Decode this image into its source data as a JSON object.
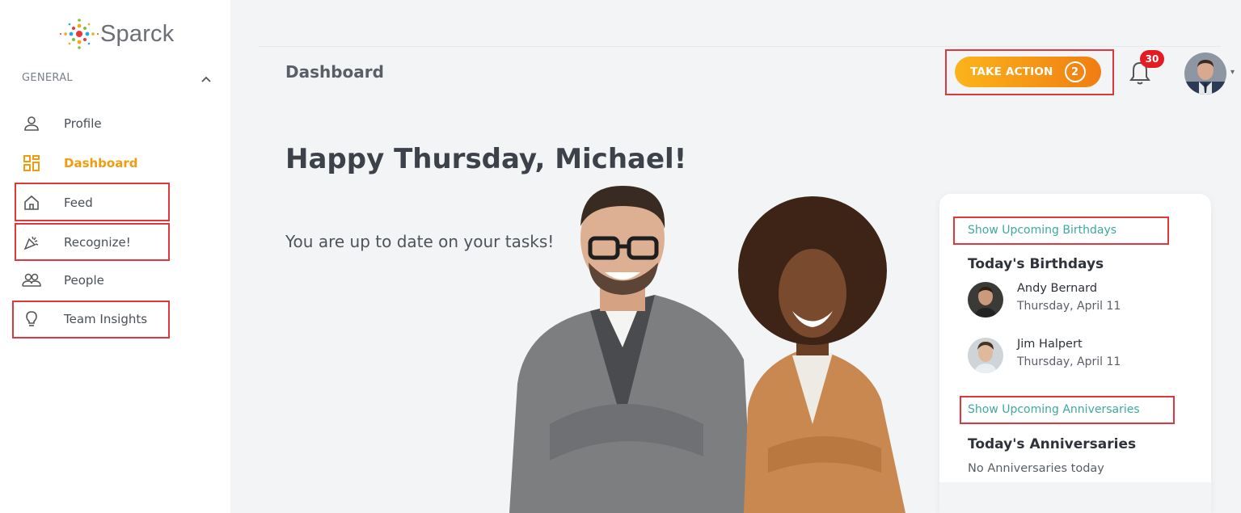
{
  "brand": {
    "name": "Sparck"
  },
  "sidebar": {
    "section_title": "GENERAL",
    "items": [
      {
        "label": "Profile",
        "icon": "user-icon"
      },
      {
        "label": "Dashboard",
        "icon": "grid-icon",
        "active": true
      },
      {
        "label": "Feed",
        "icon": "home-icon"
      },
      {
        "label": "Recognize!",
        "icon": "party-popper-icon"
      },
      {
        "label": "People",
        "icon": "people-icon"
      },
      {
        "label": "Team Insights",
        "icon": "lightbulb-icon"
      }
    ]
  },
  "header": {
    "title": "Dashboard",
    "take_action_label": "TAKE ACTION",
    "take_action_count": "2",
    "notification_count": "30"
  },
  "main": {
    "greeting": "Happy Thursday, Michael!",
    "status": "You are up to date on your tasks!"
  },
  "card": {
    "birthdays_link": "Show Upcoming Birthdays",
    "birthdays_heading": "Today's Birthdays",
    "birthdays": [
      {
        "name": "Andy Bernard",
        "date": "Thursday, April 11"
      },
      {
        "name": "Jim Halpert",
        "date": "Thursday, April 11"
      }
    ],
    "anniversaries_link": "Show Upcoming Anniversaries",
    "anniversaries_heading": "Today's Anniversaries",
    "anniversaries_empty": "No Anniversaries today"
  },
  "colors": {
    "accent": "#f29b11",
    "link": "#3ea99f",
    "highlight": "#e0373f",
    "badge": "#e31b23"
  }
}
